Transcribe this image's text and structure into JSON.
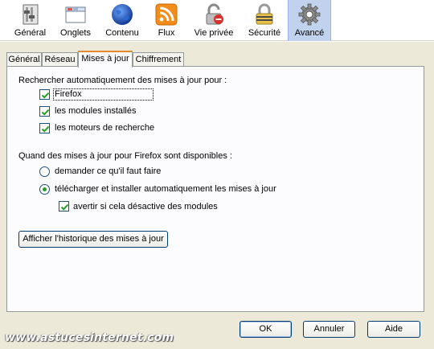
{
  "toolbar": {
    "items": [
      {
        "label": "Général",
        "icon": "general-icon"
      },
      {
        "label": "Onglets",
        "icon": "tabs-icon"
      },
      {
        "label": "Contenu",
        "icon": "globe-icon"
      },
      {
        "label": "Flux",
        "icon": "rss-icon"
      },
      {
        "label": "Vie privée",
        "icon": "privacy-icon"
      },
      {
        "label": "Sécurité",
        "icon": "lock-icon"
      },
      {
        "label": "Avancé",
        "icon": "gear-icon"
      }
    ],
    "selected": "Avancé"
  },
  "subtabs": {
    "items": [
      "Général",
      "Réseau",
      "Mises à jour",
      "Chiffrement"
    ],
    "active": "Mises à jour"
  },
  "updates": {
    "search_heading": "Rechercher automatiquement des mises à jour pour :",
    "check_firefox": {
      "label": "Firefox",
      "checked": true
    },
    "check_modules": {
      "label": "les modules installés",
      "checked": true
    },
    "check_engines": {
      "label": "les moteurs de recherche",
      "checked": true
    },
    "available_heading": "Quand des mises à jour pour Firefox sont disponibles :",
    "radio_ask": {
      "label": "demander ce qu'il faut faire",
      "selected": false
    },
    "radio_auto": {
      "label": "télécharger et installer automatiquement les mises à jour",
      "selected": true
    },
    "check_warn": {
      "label": "avertir si cela désactive des modules",
      "checked": true
    },
    "history_button": "Afficher l'historique des mises à jour"
  },
  "buttons": {
    "ok": "OK",
    "cancel": "Annuler",
    "help": "Aide"
  },
  "watermark": "www.astucesinternet.com",
  "colors": {
    "selected_tab_bg": "#c1d2ee",
    "dialog_bg": "#ece9d8",
    "check_mark": "#21a121",
    "button_border": "#003c74"
  }
}
